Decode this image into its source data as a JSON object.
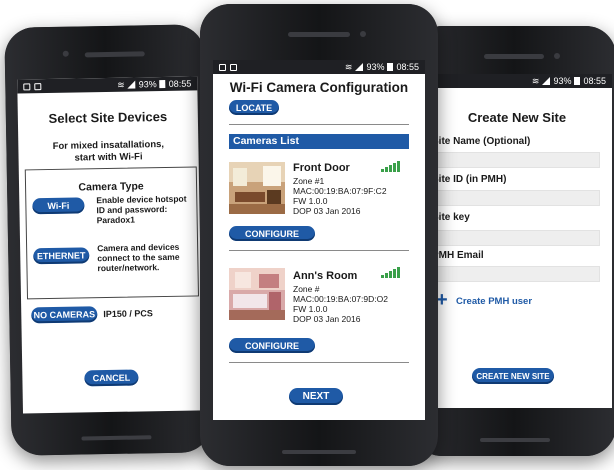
{
  "status": {
    "battery": "93%",
    "time": "08:55"
  },
  "left": {
    "title": "Select Site Devices",
    "subtitle_line1": "For mixed insatallations,",
    "subtitle_line2": "start with Wi-Fi",
    "camera_type_title": "Camera Type",
    "wifi_button": "Wi-Fi",
    "wifi_desc_1": "Enable device hotspot",
    "wifi_desc_2": "ID and password:",
    "wifi_desc_3": "Paradox1",
    "ethernet_button": "ETHERNET",
    "ethernet_desc_1": "Camera and devices",
    "ethernet_desc_2": "connect to the same",
    "ethernet_desc_3": "router/network.",
    "no_cameras_button": "NO CAMERAS",
    "no_cameras_desc": "IP150 / PCS",
    "cancel_button": "CANCEL"
  },
  "center": {
    "title": "Wi-Fi Camera Configuration",
    "locate_button": "LOCATE",
    "list_header": "Cameras List",
    "cameras": [
      {
        "name": "Front Door",
        "zone": "Zone #1",
        "mac": "MAC:00:19:BA:07:9F:C2",
        "fw": "FW 1.0.0",
        "dop": "DOP 03 Jan 2016",
        "configure_label": "CONFIGURE"
      },
      {
        "name": "Ann's Room",
        "zone": "Zone #",
        "mac": "MAC:00:19:BA:07:9D:O2",
        "fw": "FW 1.0.0",
        "dop": "DOP 03 Jan 2016",
        "configure_label": "CONFIGURE"
      }
    ],
    "next_button": "NEXT"
  },
  "right": {
    "title": "Create New Site",
    "site_name_label": "Site Name (Optional)",
    "site_id_label": "Site ID (in PMH)",
    "site_key_label": "Site key",
    "pmh_email_label": "PMH Email",
    "create_pmh_user_link": "Create PMH user",
    "create_site_button": "CREATE NEW SITE"
  },
  "colors": {
    "accent": "#1f5aa6",
    "signal": "#3aa04a"
  }
}
